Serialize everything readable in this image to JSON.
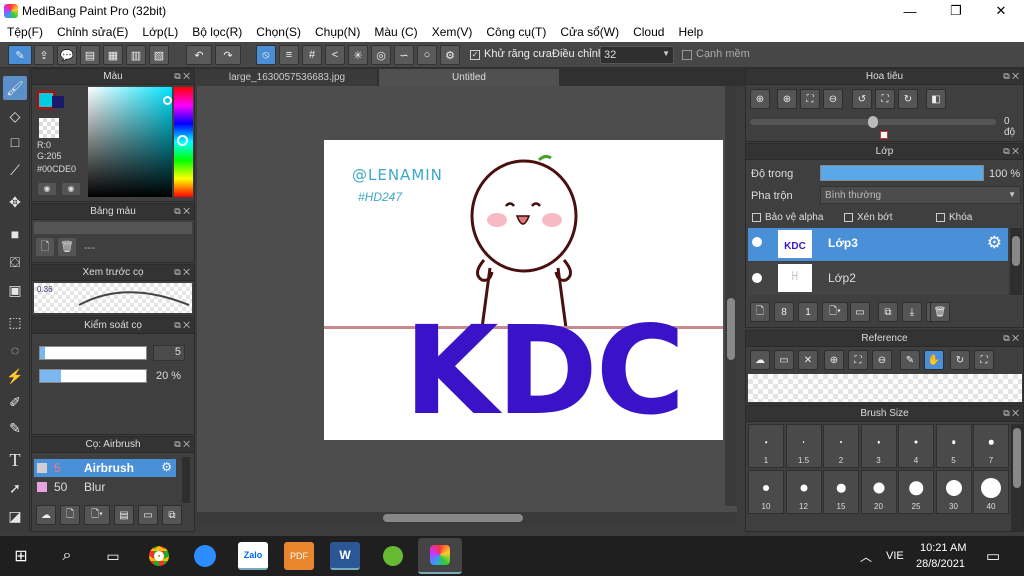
{
  "window": {
    "title": "MediBang Paint Pro (32bit)",
    "minimize": "—",
    "maximize": "❐",
    "close": "✕"
  },
  "menu": [
    "Tệp(F)",
    "Chỉnh sửa(E)",
    "Lớp(L)",
    "Bộ lọc(R)",
    "Chọn(S)",
    "Chụp(N)",
    "Màu (C)",
    "Xem(V)",
    "Công cụ(T)",
    "Cửa sổ(W)",
    "Cloud",
    "Help"
  ],
  "toolbar": {
    "antialias_label": "Khử răng cưa",
    "adjust_label": "Điều chỉnh",
    "adjust_value": "32",
    "snap_label": "Cạnh mềm"
  },
  "tabs": [
    "large_1630057536683.jpg",
    "Untitled"
  ],
  "color_panel": {
    "title": "Màu",
    "r": "R:0",
    "g": "G:205",
    "hex": "#00CDE0",
    "fg_color": "#00CDE0"
  },
  "palette_panel": {
    "title": "Bảng màu",
    "value": "---"
  },
  "brush_preview": {
    "title": "Xem trước cọ",
    "size": "0.36"
  },
  "brush_control": {
    "title": "Kiểm soát cọ",
    "size_value": "5",
    "opacity_value": "20 %",
    "size_fraction": 0.05,
    "opacity_fraction": 0.2
  },
  "brush_list": {
    "title": "Cọ: Airbrush",
    "items": [
      {
        "size": "5",
        "name": "Airbrush",
        "color": "#cfcfcf"
      },
      {
        "size": "50",
        "name": "Blur",
        "color": "#e7a3e0"
      }
    ]
  },
  "navigator": {
    "title": "Hoa tiêu",
    "angle": "0 độ"
  },
  "layer_panel": {
    "title": "Lớp",
    "opacity_label": "Độ trong",
    "opacity_value": "100 %",
    "opacity_fraction": 1.0,
    "blend_label": "Pha trộn",
    "blend_value": "Bình thường",
    "protect_alpha": "Bảo vệ alpha",
    "clipping": "Xén bớt",
    "lock": "Khóa",
    "layers": [
      {
        "name": "Lớp3",
        "thumb": "KDC"
      },
      {
        "name": "Lớp2",
        "thumb": ""
      }
    ]
  },
  "reference_panel": {
    "title": "Reference"
  },
  "brush_size_panel": {
    "title": "Brush Size",
    "sizes": [
      "1",
      "1.5",
      "2",
      "3",
      "4",
      "5",
      "7",
      "10",
      "12",
      "15",
      "20",
      "25",
      "30",
      "40"
    ]
  },
  "artwork": {
    "signature": "@LENAMIN",
    "hashtag": "#HD247",
    "text": "KDC",
    "text_color": "#3a12c8"
  },
  "taskbar": {
    "apps": [
      "Zalo",
      "PDF",
      "W"
    ],
    "lang": "VIE",
    "time": "10:21 AM",
    "date": "28/8/2021"
  }
}
